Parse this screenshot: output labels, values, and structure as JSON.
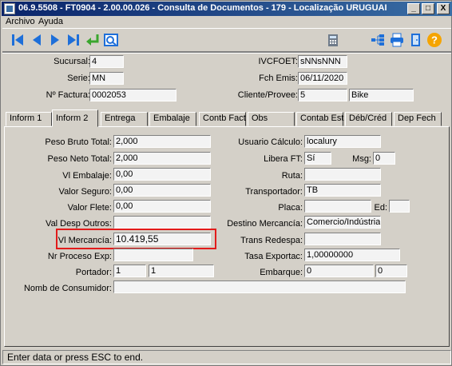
{
  "window": {
    "title": "06.9.5508 - FT0904 - 2.00.00.026 - Consulta de Documentos - 179 - Localização URUGUAI",
    "min_glyph": "_",
    "max_glyph": "□",
    "close_glyph": "X"
  },
  "menu": {
    "archivo": "Archivo",
    "ayuda": "Ayuda"
  },
  "toolbar": {
    "first_icon": "first-record-icon",
    "prev_icon": "previous-record-icon",
    "next_icon": "next-record-icon",
    "last_icon": "last-record-icon",
    "return_icon": "return-arrow-icon",
    "view_icon": "preview-icon",
    "calc_icon": "calculator-icon",
    "tree_icon": "tree-icon",
    "print_icon": "printer-icon",
    "exit_icon": "exit-door-icon",
    "help_icon": "help-icon"
  },
  "header": {
    "sucursal_label": "Sucursal:",
    "sucursal": "4",
    "serie_label": "Serie:",
    "serie": "MN",
    "factura_label": "Nº Factura:",
    "factura": "0002053",
    "ivcfoet_label": "IVCFOET:",
    "ivcfoet": "sNNsNNN",
    "fch_label": "Fch Emis:",
    "fch": "06/11/2020",
    "cliente_label": "Cliente/Provee:",
    "cliente_code": "5",
    "cliente_name": "Bike"
  },
  "tabs": [
    "Inform 1",
    "Inform 2",
    "Entrega",
    "Embalaje",
    "Contb Fact",
    "Obs",
    "Contab Est",
    "Déb/Créd",
    "Dep Fech"
  ],
  "active_tab": "Inform 2",
  "form": {
    "peso_bruto_label": "Peso Bruto Total:",
    "peso_bruto": "2,000",
    "peso_neto_label": "Peso Neto Total:",
    "peso_neto": "2,000",
    "vl_embalaje_label": "Vl Embalaje:",
    "vl_embalaje": "0,00",
    "valor_seguro_label": "Valor Seguro:",
    "valor_seguro": "0,00",
    "valor_flete_label": "Valor Flete:",
    "valor_flete": "0,00",
    "vl_desp_label": "Val Desp Outros:",
    "vl_desp": "",
    "vl_merc_label": "Vl Mercancía:",
    "vl_merc": "10.419,55",
    "nr_proceso_label": "Nr Proceso Exp:",
    "nr_proceso": "",
    "portador_label": "Portador:",
    "portador_a": "1",
    "portador_b": "1",
    "nomb_label": "Nomb de Consumidor:",
    "nomb": "",
    "usuario_label": "Usuario Cálculo:",
    "usuario": "localury",
    "libera_label": "Libera FT:",
    "libera": "Sí",
    "msg_label": "Msg:",
    "msg": "0",
    "ruta_label": "Ruta:",
    "ruta": "",
    "transportador_label": "Transportador:",
    "transportador": "TB",
    "placa_label": "Placa:",
    "placa": "",
    "ed_label": "Ed:",
    "ed": "",
    "destino_label": "Destino Mercancía:",
    "destino": "Comercio/Indústria",
    "trans_redespa_label": "Trans Redespa:",
    "trans_redespa": "",
    "tasa_label": "Tasa Exportac:",
    "tasa": "1,00000000",
    "embarque_label": "Embarque:",
    "embarque_a": "0",
    "embarque_b": "0"
  },
  "status": "Enter data or press ESC to end.",
  "colors": {
    "titlebar_start": "#0a246a",
    "titlebar_end": "#3a6ea5",
    "highlight": "#e21b1b",
    "icon_blue": "#1e6fd9"
  }
}
